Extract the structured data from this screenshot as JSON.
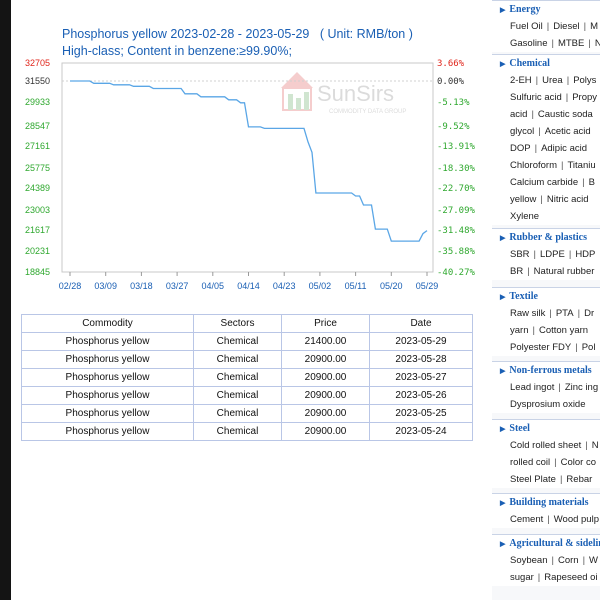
{
  "chart": {
    "title": "Phosphorus yellow 2023-02-28 - 2023-05-29",
    "unit": "( Unit: RMB/ton )",
    "subtitle": "High-class; Content in benzene:≥99.90%;",
    "watermark": "SunSirs",
    "watermark_sub": "COMMODITY DATA GROUP",
    "accent_color": "#5aa6e6"
  },
  "chart_data": {
    "type": "line",
    "title": "Phosphorus yellow 2023-02-28 - 2023-05-29",
    "x_ticks": [
      "02/28",
      "03/09",
      "03/18",
      "03/27",
      "04/05",
      "04/14",
      "04/23",
      "05/02",
      "05/11",
      "05/20",
      "05/29"
    ],
    "y_ticks_left": [
      "32705",
      "31550",
      "29933",
      "28547",
      "27161",
      "25775",
      "24389",
      "23003",
      "21617",
      "20231",
      "18845"
    ],
    "y_ticks_right": [
      "3.66%",
      "0.00%",
      "-5.13%",
      "-9.52%",
      "-13.91%",
      "-18.30%",
      "-22.70%",
      "-27.09%",
      "-31.48%",
      "-35.88%",
      "-40.27%"
    ],
    "ylim": [
      18845,
      32705
    ],
    "series": [
      {
        "x_day": [
          0,
          5,
          6,
          10,
          11,
          15,
          16,
          20,
          21,
          28,
          29,
          32,
          33,
          39,
          40,
          42,
          43,
          44,
          45,
          48,
          49,
          59,
          60,
          61,
          62,
          71,
          72,
          73,
          74,
          76,
          77,
          80,
          81,
          83,
          84,
          88,
          89,
          90
        ],
        "values": [
          31550,
          31550,
          31400,
          31400,
          31300,
          31300,
          31200,
          31200,
          31050,
          31050,
          30700,
          30700,
          30500,
          30500,
          30300,
          30300,
          30100,
          30100,
          28500,
          28500,
          28400,
          28400,
          27500,
          26800,
          24100,
          24100,
          23900,
          23900,
          23300,
          23300,
          21700,
          21700,
          20900,
          20900,
          20900,
          20900,
          21400,
          21600
        ]
      }
    ]
  },
  "table": {
    "headers": [
      "Commodity",
      "Sectors",
      "Price",
      "Date"
    ],
    "rows": [
      [
        "Phosphorus yellow",
        "Chemical",
        "21400.00",
        "2023-05-29"
      ],
      [
        "Phosphorus yellow",
        "Chemical",
        "20900.00",
        "2023-05-28"
      ],
      [
        "Phosphorus yellow",
        "Chemical",
        "20900.00",
        "2023-05-27"
      ],
      [
        "Phosphorus yellow",
        "Chemical",
        "20900.00",
        "2023-05-26"
      ],
      [
        "Phosphorus yellow",
        "Chemical",
        "20900.00",
        "2023-05-25"
      ],
      [
        "Phosphorus yellow",
        "Chemical",
        "20900.00",
        "2023-05-24"
      ]
    ]
  },
  "sidebar": {
    "categories": [
      {
        "title": "Energy",
        "lines": [
          [
            "Fuel Oil",
            "Diesel",
            "M"
          ],
          [
            "Gasoline",
            "MTBE",
            "N"
          ]
        ]
      },
      {
        "title": "Chemical",
        "lines": [
          [
            "2-EH",
            "Urea",
            "Polys"
          ],
          [
            "Sulfuric acid",
            "Propy"
          ],
          [
            "acid",
            "Caustic soda"
          ],
          [
            "glycol",
            "Acetic acid"
          ],
          [
            "DOP",
            "Adipic acid"
          ],
          [
            "Chloroform",
            "Titaniu"
          ],
          [
            "Calcium carbide",
            "B"
          ],
          [
            "yellow",
            "Nitric acid"
          ],
          [
            "Xylene"
          ]
        ]
      },
      {
        "title": "Rubber & plastics",
        "lines": [
          [
            "SBR",
            "LDPE",
            "HDP"
          ],
          [
            "BR",
            "Natural rubber"
          ]
        ]
      },
      {
        "title": "Textile",
        "lines": [
          [
            "Raw silk",
            "PTA",
            "Dr"
          ],
          [
            "yarn",
            "Cotton yarn"
          ],
          [
            "Polyester FDY",
            "Pol"
          ]
        ]
      },
      {
        "title": "Non-ferrous metals",
        "lines": [
          [
            "Lead ingot",
            "Zinc ing"
          ],
          [
            "Dysprosium oxide"
          ]
        ]
      },
      {
        "title": "Steel",
        "lines": [
          [
            "Cold rolled sheet",
            "N"
          ],
          [
            "rolled coil",
            "Color co"
          ],
          [
            "Steel Plate",
            "Rebar"
          ]
        ]
      },
      {
        "title": "Building materials",
        "lines": [
          [
            "Cement",
            "Wood pulp"
          ]
        ]
      },
      {
        "title": "Agricultural & sideline",
        "lines": [
          [
            "Soybean",
            "Corn",
            "W"
          ],
          [
            "sugar",
            "Rapeseed oi"
          ]
        ]
      }
    ]
  }
}
